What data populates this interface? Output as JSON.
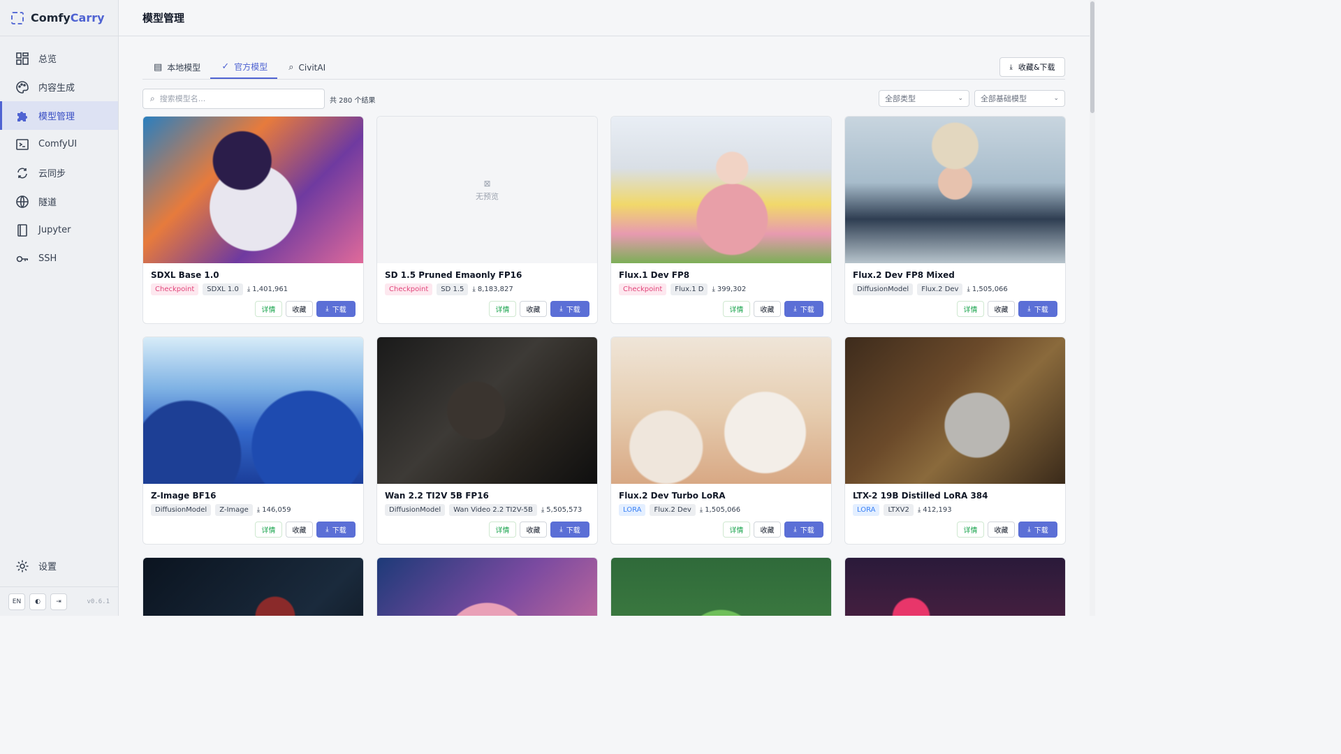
{
  "brand": {
    "name_part1": "Comfy",
    "name_part2": "Carry"
  },
  "page_title": "模型管理",
  "sidebar": {
    "items": [
      {
        "label": "总览",
        "icon": "dashboard-icon"
      },
      {
        "label": "内容生成",
        "icon": "palette-icon"
      },
      {
        "label": "模型管理",
        "icon": "puzzle-icon",
        "active": true
      },
      {
        "label": "ComfyUI",
        "icon": "terminal-icon"
      },
      {
        "label": "云同步",
        "icon": "cloud-sync-icon"
      },
      {
        "label": "隧道",
        "icon": "globe-icon"
      },
      {
        "label": "Jupyter",
        "icon": "notebook-icon"
      },
      {
        "label": "SSH",
        "icon": "key-icon"
      }
    ],
    "settings_label": "设置",
    "lang_label": "EN",
    "version": "v0.6.1"
  },
  "tabs": [
    {
      "label": "本地模型",
      "icon": "archive-icon"
    },
    {
      "label": "官方模型",
      "icon": "verified-icon",
      "active": true
    },
    {
      "label": "CivitAI",
      "icon": "search-icon"
    }
  ],
  "toolbar": {
    "fav_download_label": "收藏&下载",
    "search_placeholder": "搜索模型名...",
    "result_count": "共 280 个结果",
    "type_filter": "全部类型",
    "base_filter": "全部基础模型"
  },
  "card_labels": {
    "detail": "详情",
    "favorite": "收藏",
    "download": "下载",
    "no_preview": "无预览"
  },
  "cards": [
    {
      "name": "SDXL Base 1.0",
      "type": "Checkpoint",
      "base": "SDXL 1.0",
      "downloads": "1,401,961"
    },
    {
      "name": "SD 1.5 Pruned Emaonly FP16",
      "type": "Checkpoint",
      "base": "SD 1.5",
      "downloads": "8,183,827"
    },
    {
      "name": "Flux.1 Dev FP8",
      "type": "Checkpoint",
      "base": "Flux.1 D",
      "downloads": "399,302"
    },
    {
      "name": "Flux.2 Dev FP8 Mixed",
      "type": "DiffusionModel",
      "base": "Flux.2 Dev",
      "downloads": "1,505,066"
    },
    {
      "name": "Z-Image BF16",
      "type": "DiffusionModel",
      "base": "Z-Image",
      "downloads": "146,059"
    },
    {
      "name": "Wan 2.2 TI2V 5B FP16",
      "type": "DiffusionModel",
      "base": "Wan Video 2.2 TI2V-5B",
      "downloads": "5,505,573"
    },
    {
      "name": "Flux.2 Dev Turbo LoRA",
      "type": "LORA",
      "base": "Flux.2 Dev",
      "downloads": "1,505,066"
    },
    {
      "name": "LTX-2 19B Distilled LoRA 384",
      "type": "LORA",
      "base": "LTXV2",
      "downloads": "412,193"
    }
  ]
}
